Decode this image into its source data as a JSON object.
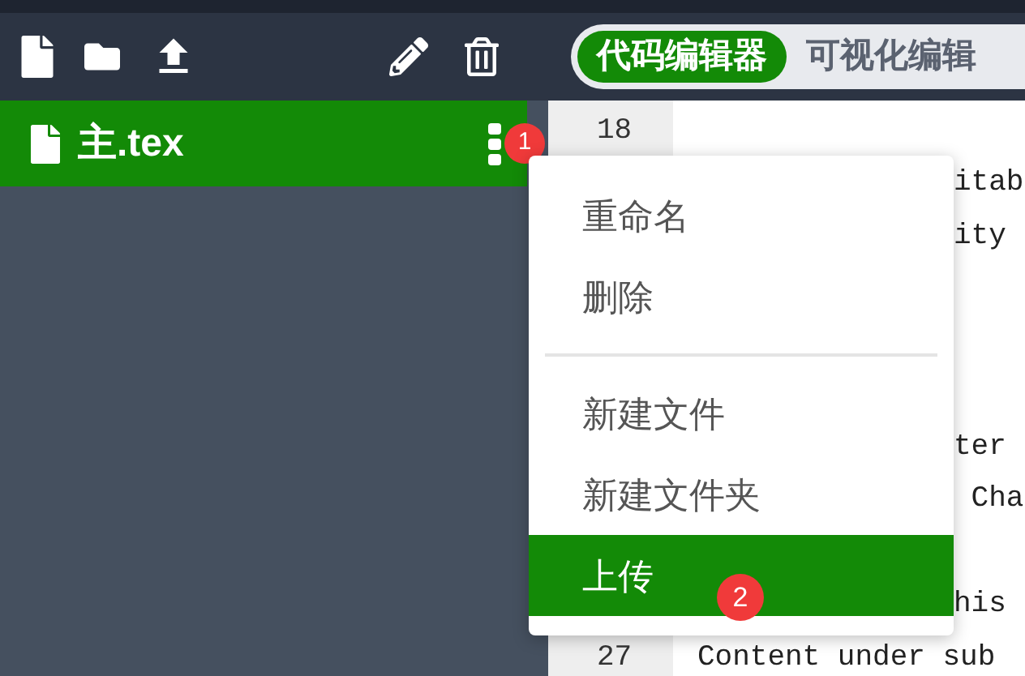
{
  "toolbar": {
    "mode_toggle": [
      {
        "label": "代码编辑器",
        "selected": true
      },
      {
        "label": "可视化编辑",
        "selected": false
      }
    ]
  },
  "file_list": [
    {
      "name": "主.tex",
      "selected": true,
      "marker": "1"
    }
  ],
  "editor": {
    "lines": [
      {
        "number": "18",
        "kind": "blank"
      },
      {
        "text": "itab",
        "kind": "covered"
      },
      {
        "text": "ity",
        "kind": "covered"
      },
      {
        "kind": "blank"
      },
      {
        "kind": "blank"
      },
      {
        "kind": "blank"
      },
      {
        "text": "ter",
        "kind": "covered"
      },
      {
        "text": " Cha",
        "kind": "covered"
      },
      {
        "kind": "blank"
      },
      {
        "text": "his",
        "kind": "covered"
      },
      {
        "number": "27",
        "text": "Content under sub",
        "kind": "full"
      }
    ]
  },
  "context_menu": {
    "groups": [
      [
        {
          "label": "重命名",
          "selected": false
        },
        {
          "label": "删除",
          "selected": false
        }
      ],
      [
        {
          "label": "新建文件",
          "selected": false
        },
        {
          "label": "新建文件夹",
          "selected": false
        },
        {
          "label": "上传",
          "selected": true,
          "marker": "2"
        }
      ]
    ]
  }
}
